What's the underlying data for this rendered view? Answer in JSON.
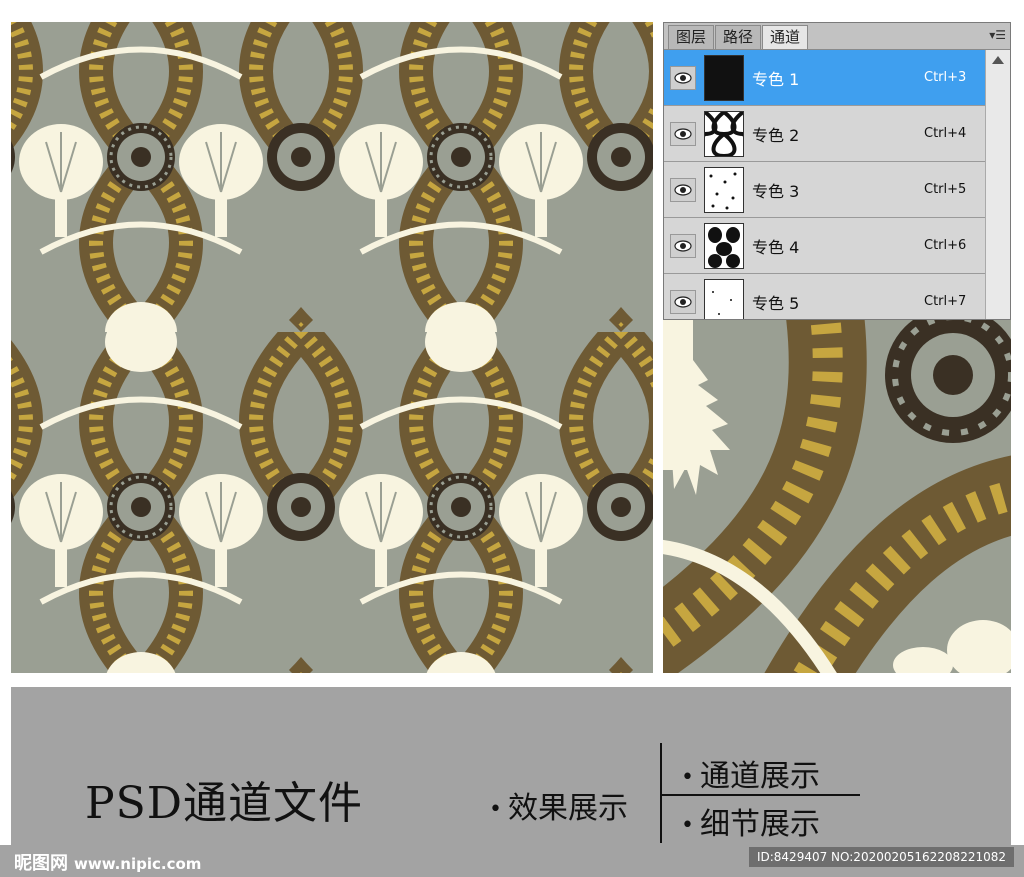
{
  "palette": {
    "tabs": [
      {
        "label": "图层",
        "active": false
      },
      {
        "label": "路径",
        "active": false
      },
      {
        "label": "通道",
        "active": true
      }
    ],
    "menu_icon": "panel-menu-icon",
    "channels": [
      {
        "name": "专色 1",
        "shortcut": "Ctrl+3",
        "selected": true
      },
      {
        "name": "专色 2",
        "shortcut": "Ctrl+4",
        "selected": false
      },
      {
        "name": "专色 3",
        "shortcut": "Ctrl+5",
        "selected": false
      },
      {
        "name": "专色 4",
        "shortcut": "Ctrl+6",
        "selected": false
      },
      {
        "name": "专色 5",
        "shortcut": "Ctrl+7",
        "selected": false
      }
    ]
  },
  "banner": {
    "title": "PSD通道文件",
    "item_effect": "效果展示",
    "item_channel": "通道展示",
    "item_detail": "细节展示"
  },
  "footer": {
    "watermark": "昵图网",
    "site": "www.nipic.com",
    "id_text": "ID:8429407 NO:20200205162208221082"
  },
  "colors": {
    "background": "#9a9f93",
    "cream": "#f8f4e0",
    "brown": "#6e5a34",
    "gold": "#c6a640",
    "dark": "#3a3024",
    "selection": "#3f9fef"
  }
}
